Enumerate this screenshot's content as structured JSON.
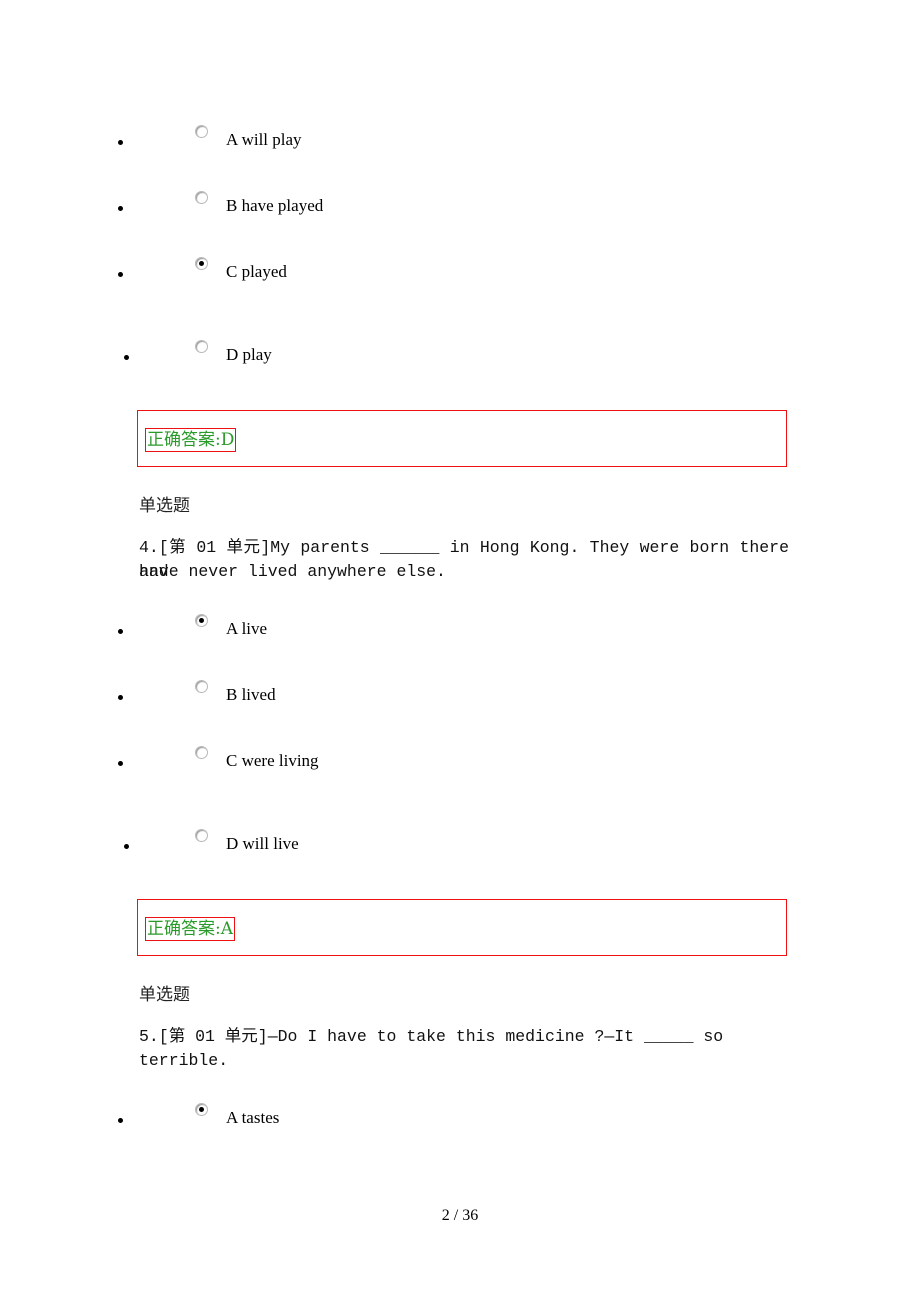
{
  "q3": {
    "options": [
      {
        "label": "A will play",
        "checked": false
      },
      {
        "label": "B have played",
        "checked": false
      },
      {
        "label": "C played",
        "checked": true
      },
      {
        "label": "D play",
        "checked": false
      }
    ],
    "answer": "正确答案:D"
  },
  "q4": {
    "type": "单选题",
    "line1": "4.[第 01 单元]My parents ______ in Hong Kong. They were born there and",
    "line2": "have never lived anywhere else.",
    "options": [
      {
        "label": "A live",
        "checked": true
      },
      {
        "label": "B lived",
        "checked": false
      },
      {
        "label": "C were living",
        "checked": false
      },
      {
        "label": "D will live",
        "checked": false
      }
    ],
    "answer": "正确答案:A"
  },
  "q5": {
    "type": "单选题",
    "line1": "5.[第 01 单元]—Do I have to take this medicine ?—It _____ so",
    "line2": "terrible.",
    "options": [
      {
        "label": "A tastes",
        "checked": true
      }
    ]
  },
  "footer": {
    "page_number": "2 / 36"
  }
}
